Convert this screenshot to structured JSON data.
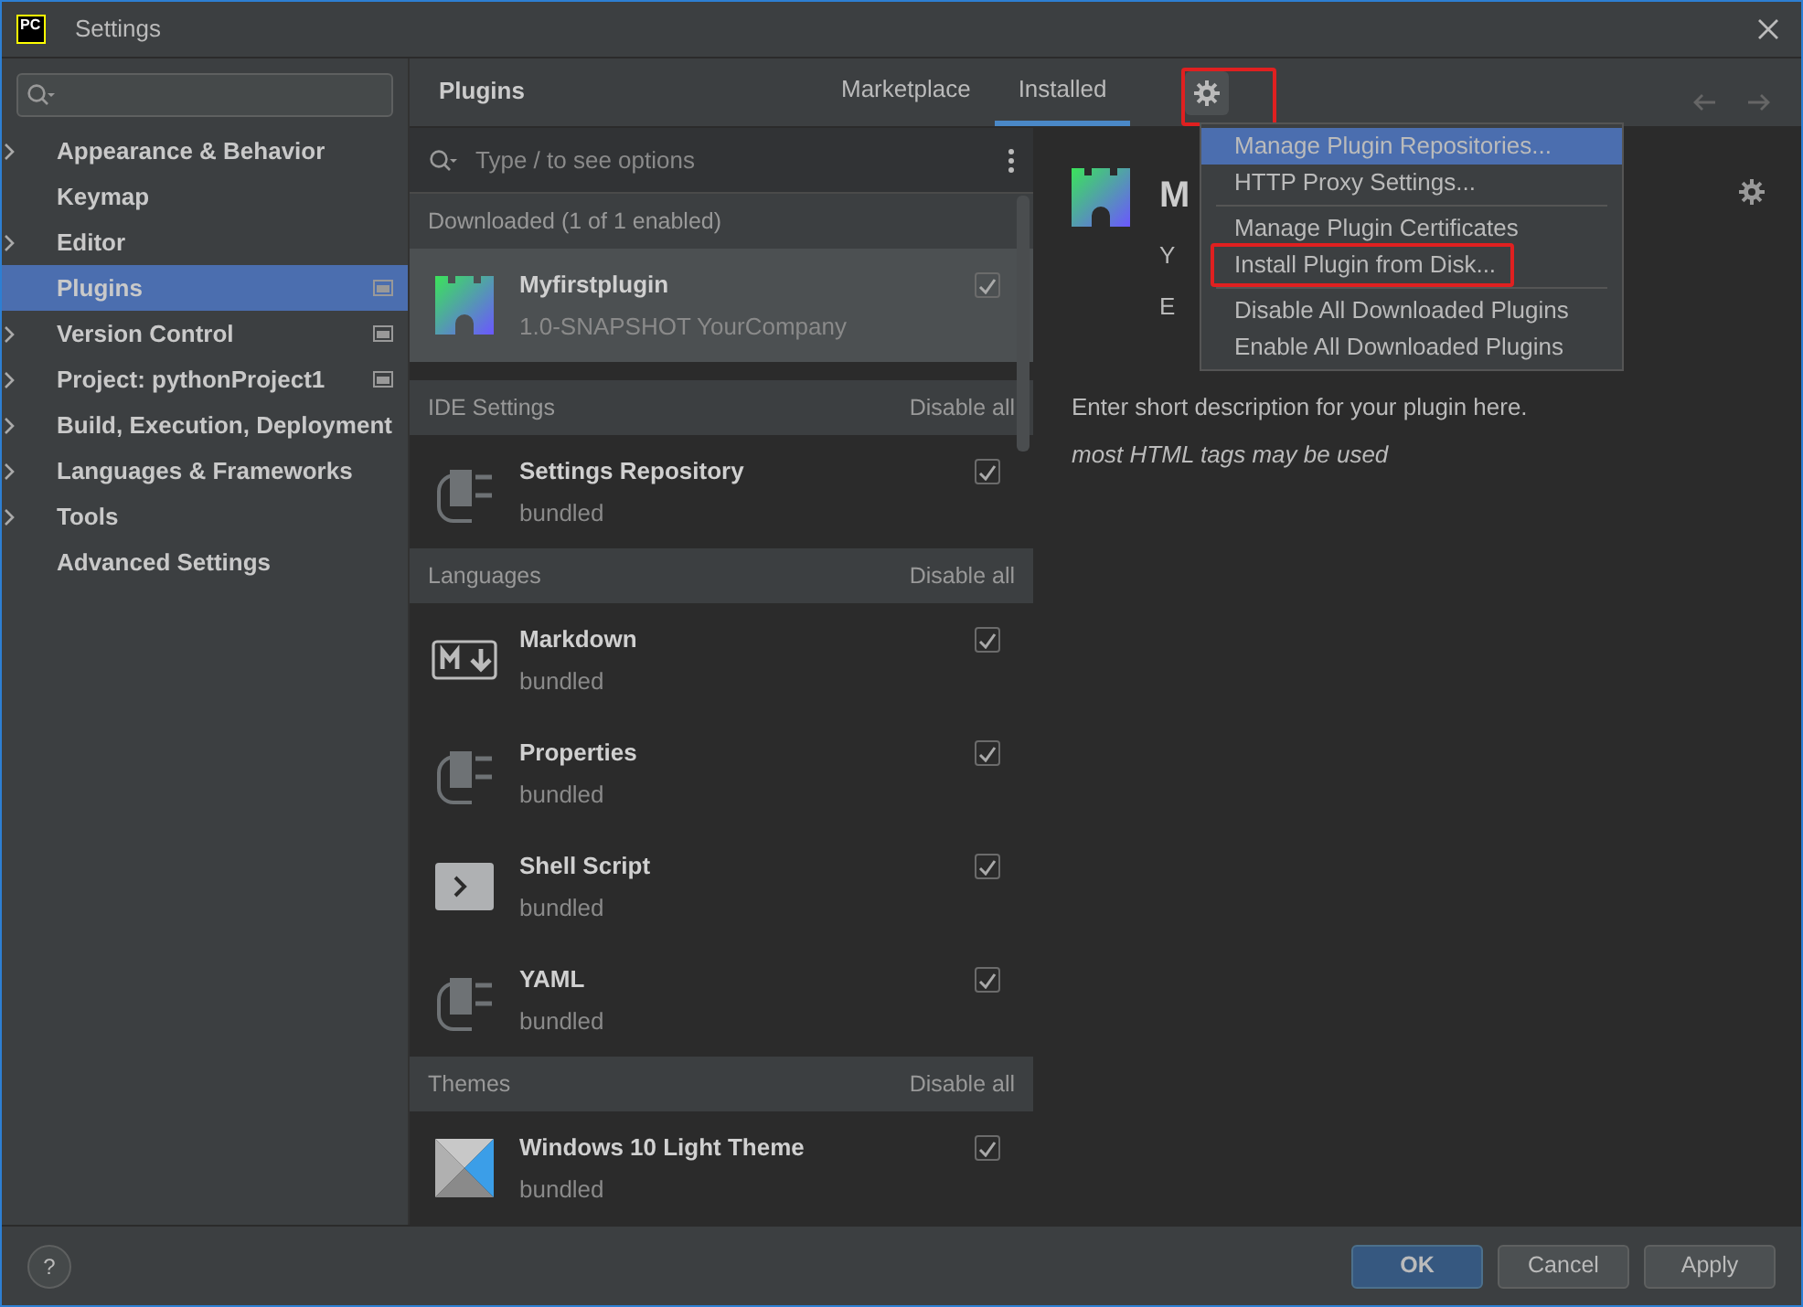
{
  "window": {
    "logo": "PC",
    "title": "Settings"
  },
  "sidebar": {
    "items": [
      {
        "label": "Appearance & Behavior",
        "expandable": true,
        "project_level": false,
        "selected": false
      },
      {
        "label": "Keymap",
        "expandable": false,
        "project_level": false,
        "selected": false
      },
      {
        "label": "Editor",
        "expandable": true,
        "project_level": false,
        "selected": false
      },
      {
        "label": "Plugins",
        "expandable": false,
        "project_level": true,
        "selected": true
      },
      {
        "label": "Version Control",
        "expandable": true,
        "project_level": true,
        "selected": false
      },
      {
        "label": "Project: pythonProject1",
        "expandable": true,
        "project_level": true,
        "selected": false
      },
      {
        "label": "Build, Execution, Deployment",
        "expandable": true,
        "project_level": false,
        "selected": false
      },
      {
        "label": "Languages & Frameworks",
        "expandable": true,
        "project_level": false,
        "selected": false
      },
      {
        "label": "Tools",
        "expandable": true,
        "project_level": false,
        "selected": false
      },
      {
        "label": "Advanced Settings",
        "expandable": false,
        "project_level": false,
        "selected": false
      }
    ]
  },
  "header": {
    "title": "Plugins",
    "tabs": [
      {
        "label": "Marketplace",
        "selected": false
      },
      {
        "label": "Installed",
        "selected": true
      }
    ],
    "gear_highlighted": true
  },
  "search": {
    "placeholder": "Type / to see options"
  },
  "sections": [
    {
      "title": "Downloaded (1 of 1 enabled)",
      "plugins": [
        {
          "name": "Myfirstplugin",
          "meta": "1.0-SNAPSHOT  YourCompany",
          "kind": "custom",
          "enabled": true,
          "selected": true
        }
      ]
    },
    {
      "title": "IDE Settings",
      "action": "Disable all",
      "plugins": [
        {
          "name": "Settings Repository",
          "meta": "bundled",
          "kind": "plug",
          "enabled": true,
          "selected": false
        }
      ]
    },
    {
      "title": "Languages",
      "action": "Disable all",
      "plugins": [
        {
          "name": "Markdown",
          "meta": "bundled",
          "kind": "markdown",
          "enabled": true,
          "selected": false
        },
        {
          "name": "Properties",
          "meta": "bundled",
          "kind": "plug",
          "enabled": true,
          "selected": false
        },
        {
          "name": "Shell Script",
          "meta": "bundled",
          "kind": "shell",
          "enabled": true,
          "selected": false
        },
        {
          "name": "YAML",
          "meta": "bundled",
          "kind": "plug",
          "enabled": true,
          "selected": false
        }
      ]
    },
    {
      "title": "Themes",
      "action": "Disable all",
      "plugins": [
        {
          "name": "Windows 10 Light Theme",
          "meta": "bundled",
          "kind": "theme",
          "enabled": true,
          "selected": false
        }
      ]
    }
  ],
  "detail": {
    "name": "M",
    "vendor": "Y",
    "line3": "E",
    "description": "Enter short description for your plugin here.",
    "note": "most HTML tags may be used"
  },
  "menu": {
    "groups": [
      [
        {
          "label": "Manage Plugin Repositories...",
          "selected": true,
          "highlighted": false
        },
        {
          "label": "HTTP Proxy Settings...",
          "selected": false,
          "highlighted": false
        }
      ],
      [
        {
          "label": "Manage Plugin Certificates",
          "selected": false,
          "highlighted": false
        },
        {
          "label": "Install Plugin from Disk...",
          "selected": false,
          "highlighted": true
        }
      ],
      [
        {
          "label": "Disable All Downloaded Plugins",
          "selected": false,
          "highlighted": false
        },
        {
          "label": "Enable All Downloaded Plugins",
          "selected": false,
          "highlighted": false
        }
      ]
    ]
  },
  "footer": {
    "help": "?",
    "buttons": [
      {
        "label": "OK",
        "primary": true
      },
      {
        "label": "Cancel",
        "primary": false
      },
      {
        "label": "Apply",
        "primary": false
      }
    ]
  }
}
